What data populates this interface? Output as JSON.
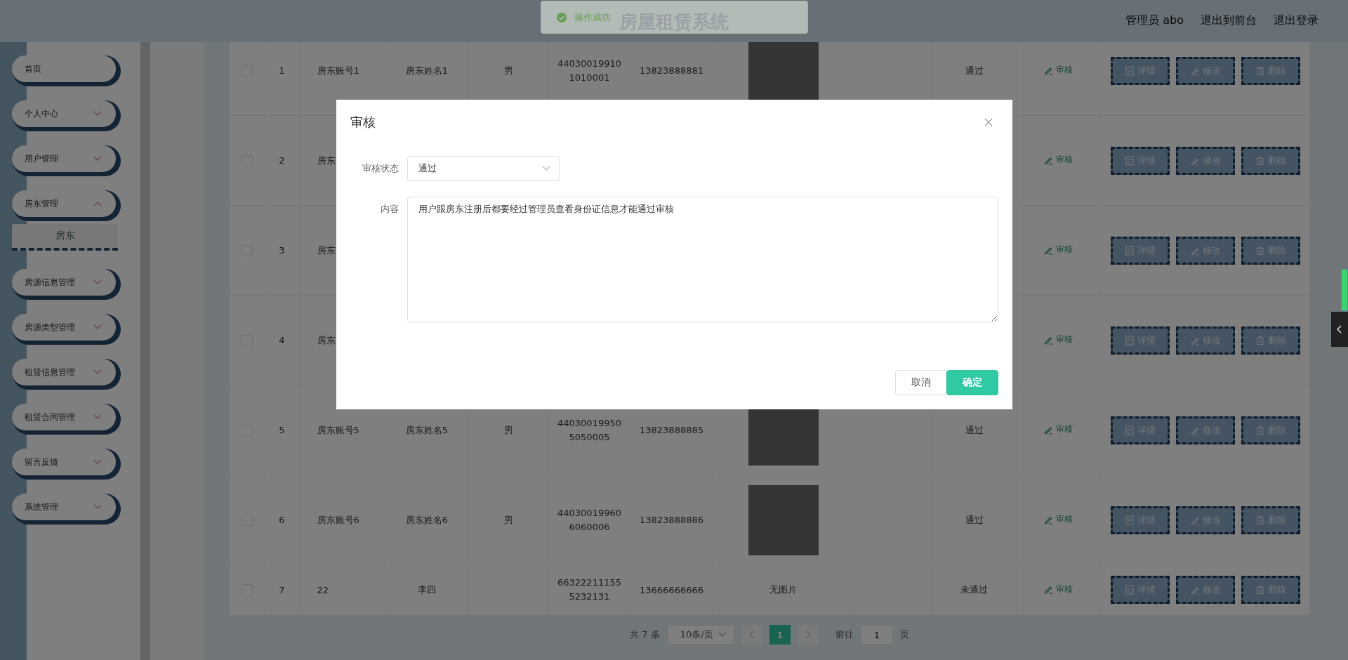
{
  "header": {
    "title": "房屋租赁系统",
    "links": [
      "管理员 abo",
      "退出到前台",
      "退出登录"
    ]
  },
  "toast": {
    "kind": "success",
    "text": "操作成功"
  },
  "sidebar": {
    "items": [
      {
        "label": "首页",
        "kind": "link"
      },
      {
        "label": "个人中心",
        "kind": "submenu",
        "expanded": false
      },
      {
        "label": "用户管理",
        "kind": "submenu",
        "expanded": false
      },
      {
        "label": "房东管理",
        "kind": "submenu",
        "expanded": true,
        "children": [
          {
            "label": "房东"
          }
        ]
      },
      {
        "label": "房源信息管理",
        "kind": "submenu",
        "expanded": false
      },
      {
        "label": "房源类型管理",
        "kind": "submenu",
        "expanded": false
      },
      {
        "label": "租赁信息管理",
        "kind": "submenu",
        "expanded": false
      },
      {
        "label": "租赁合同管理",
        "kind": "submenu",
        "expanded": false
      },
      {
        "label": "留言反馈",
        "kind": "submenu",
        "expanded": false
      },
      {
        "label": "系统管理",
        "kind": "submenu",
        "expanded": false
      }
    ]
  },
  "table": {
    "rows": [
      {
        "checked": false,
        "index": "1",
        "account": "房东账号1",
        "name": "房东姓名1",
        "gender": "男",
        "id_number": "440300199101010001",
        "phone": "13823888881",
        "has_photo": true,
        "status": "通过",
        "review": "审核",
        "actions": [
          {
            "kind": "detail",
            "label": "详情"
          },
          {
            "kind": "edit",
            "label": "修改"
          },
          {
            "kind": "delete",
            "label": "删除"
          }
        ]
      },
      {
        "checked": false,
        "index": "2",
        "account": "房东",
        "review": "审核",
        "actions": [
          {
            "kind": "detail",
            "label": "详情"
          },
          {
            "kind": "edit",
            "label": "修改"
          },
          {
            "kind": "delete",
            "label": "删除"
          }
        ]
      },
      {
        "checked": false,
        "index": "3",
        "account": "房东",
        "review": "审核",
        "actions": [
          {
            "kind": "detail",
            "label": "详情"
          },
          {
            "kind": "edit",
            "label": "修改"
          },
          {
            "kind": "delete",
            "label": "删除"
          }
        ]
      },
      {
        "checked": false,
        "index": "4",
        "account": "房东",
        "review": "审核",
        "actions": [
          {
            "kind": "detail",
            "label": "详情"
          },
          {
            "kind": "edit",
            "label": "修改"
          },
          {
            "kind": "delete",
            "label": "删除"
          }
        ]
      },
      {
        "checked": false,
        "index": "5",
        "account": "房东账号5",
        "name": "房东姓名5",
        "gender": "男",
        "id_number": "440300199505050005",
        "phone": "13823888885",
        "has_photo": true,
        "status": "通过",
        "review": "审核",
        "actions": [
          {
            "kind": "detail",
            "label": "详情"
          },
          {
            "kind": "edit",
            "label": "修改"
          },
          {
            "kind": "delete",
            "label": "删除"
          }
        ]
      },
      {
        "checked": false,
        "index": "6",
        "account": "房东账号6",
        "name": "房东姓名6",
        "gender": "男",
        "id_number": "440300199606060006",
        "phone": "13823888886",
        "has_photo": true,
        "status": "通过",
        "review": "审核",
        "actions": [
          {
            "kind": "detail",
            "label": "详情"
          },
          {
            "kind": "edit",
            "label": "修改"
          },
          {
            "kind": "delete",
            "label": "删除"
          }
        ]
      },
      {
        "checked": false,
        "index": "7",
        "account": "22",
        "name": "李四",
        "id_number": "663222111555232131",
        "phone": "13666666666",
        "photo_text": "无图片",
        "status": "未通过",
        "review": "审核",
        "actions": [
          {
            "kind": "detail",
            "label": "详情"
          },
          {
            "kind": "edit",
            "label": "修改"
          },
          {
            "kind": "delete",
            "label": "删除"
          }
        ]
      }
    ]
  },
  "pagination": {
    "total": "共 7 条",
    "page_size": "10条/页",
    "pages": [
      {
        "label": "1",
        "selected": true
      }
    ],
    "goto_label": "前往",
    "goto_value": "1",
    "goto_suffix": "页"
  },
  "dialog": {
    "title": "审核",
    "fields": [
      {
        "kind": "select",
        "label": "审核状态",
        "value": "通过"
      },
      {
        "kind": "textarea",
        "label": "内容",
        "value": "用户跟房东注册后都要经过管理员查看身份证信息才能通过审核"
      }
    ],
    "buttons": [
      {
        "kind": "secondary",
        "label": "取消"
      },
      {
        "kind": "primary",
        "label": "确定"
      }
    ]
  }
}
